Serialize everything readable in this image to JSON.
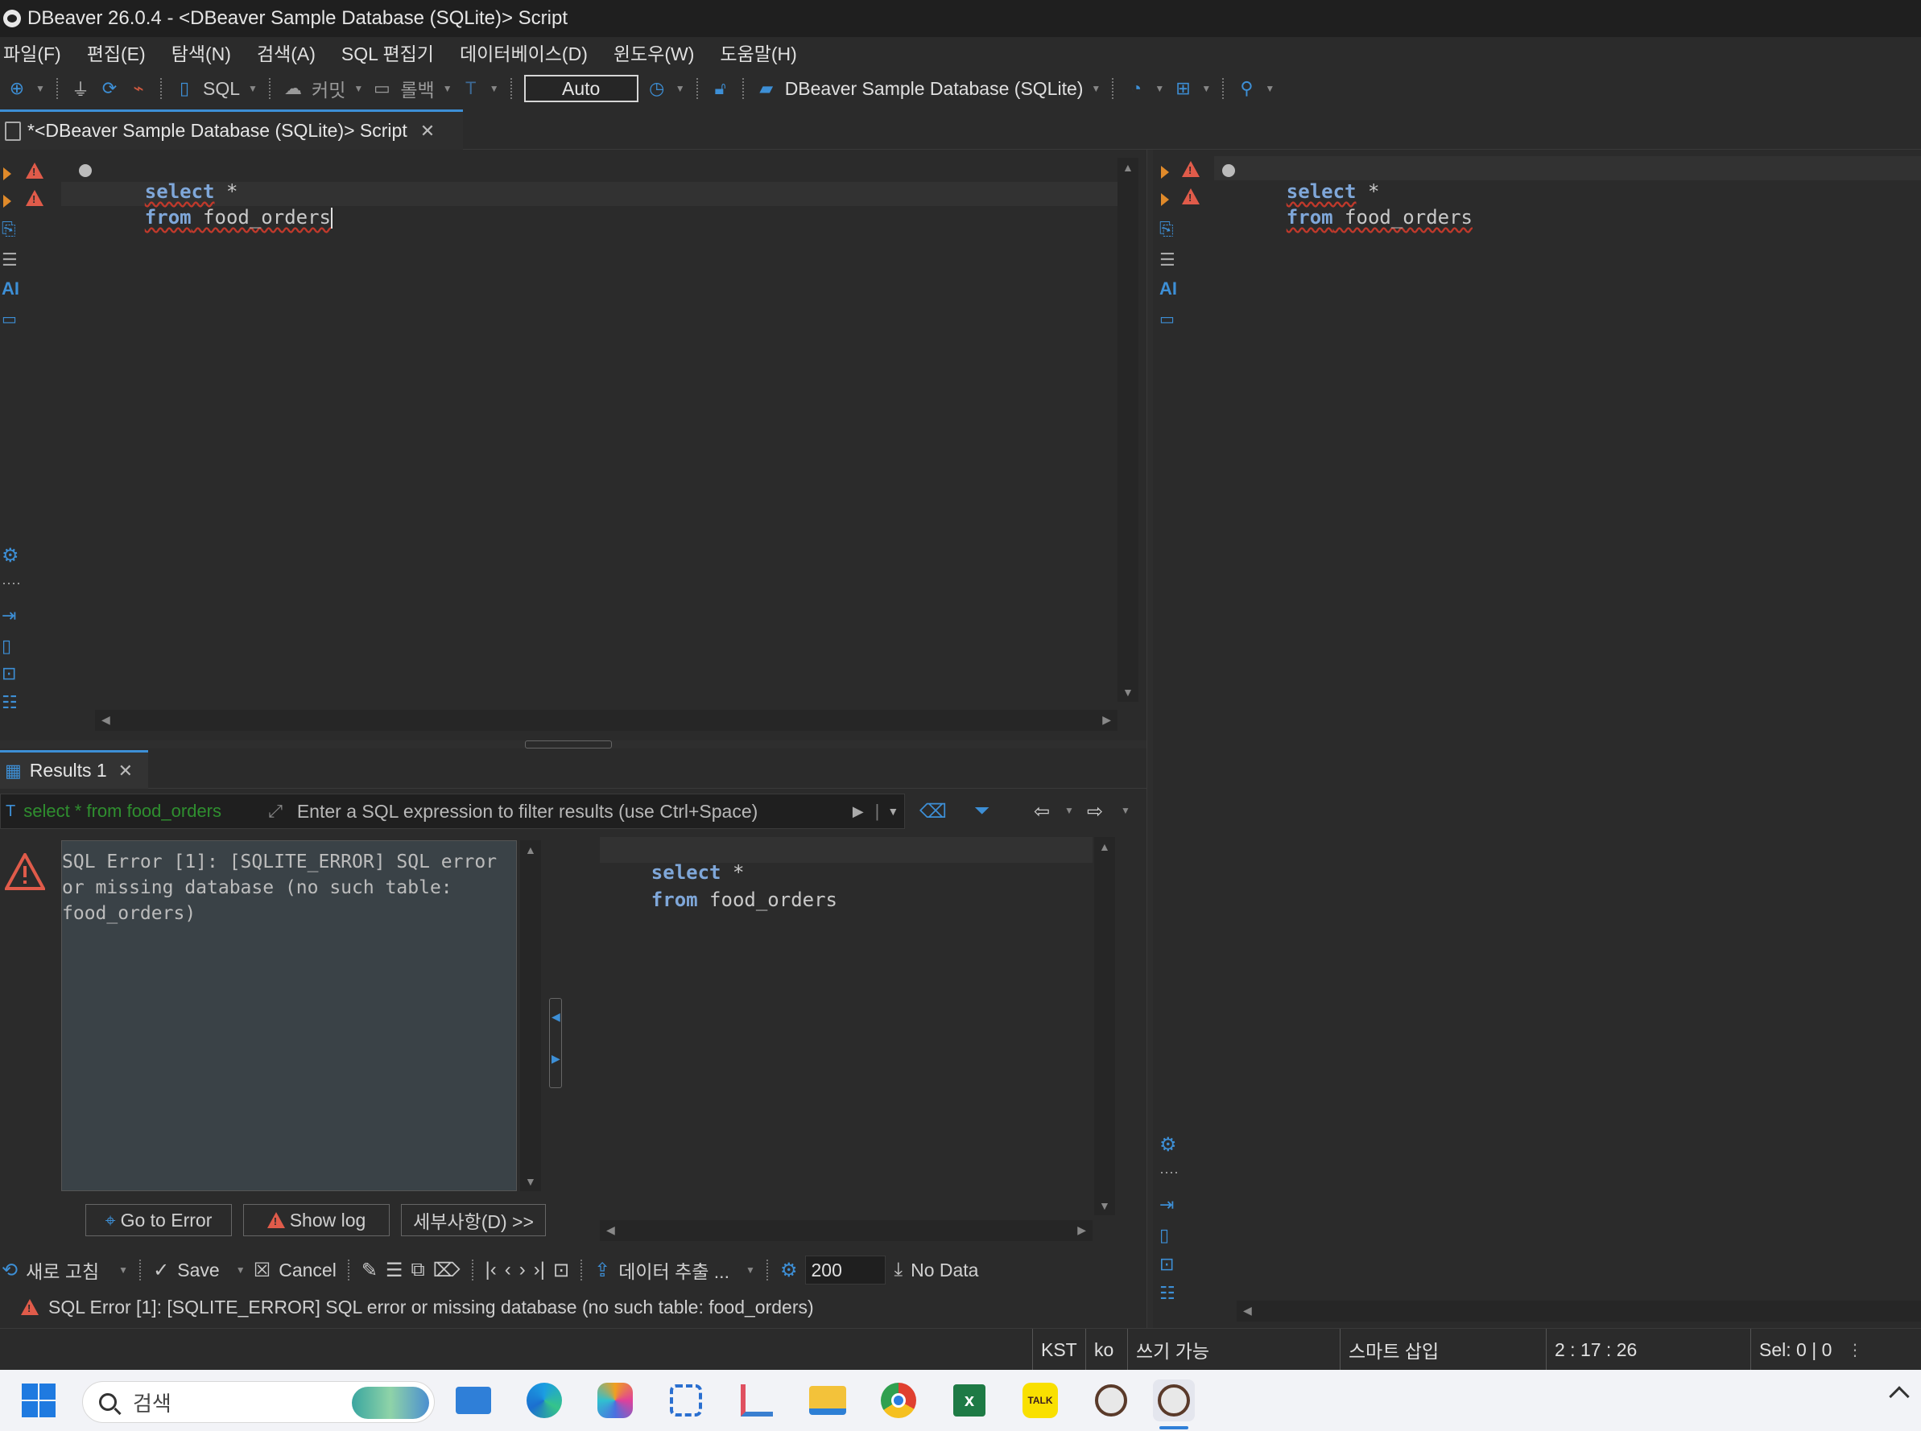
{
  "window": {
    "title": "DBeaver 26.0.4 - <DBeaver Sample Database (SQLite)> Script"
  },
  "menu": [
    "파일(F)",
    "편집(E)",
    "탐색(N)",
    "검색(A)",
    "SQL 편집기",
    "데이터베이스(D)",
    "윈도우(W)",
    "도움말(H)"
  ],
  "toolbar": {
    "sql_label": "SQL",
    "commit_label": "커밋",
    "rollback_label": "롤백",
    "transaction_mode": "Auto",
    "datasource": "DBeaver Sample Database (SQLite)"
  },
  "editor": {
    "tab_label": "*<DBeaver Sample Database (SQLite)> Script",
    "line1_kw": "select",
    "line1_rest": " *",
    "line2_kw": "from",
    "line2_rest": " food_orders"
  },
  "results": {
    "tab_label": "Results 1",
    "filter_query": "select * from food_orders",
    "filter_placeholder": "Enter a SQL expression to filter results (use Ctrl+Space)",
    "error_message": "SQL Error [1]: [SQLITE_ERROR] SQL error or missing database (no such table: food_orders)",
    "go_to_error": "Go to Error",
    "show_log": "Show log",
    "details": "세부사항(D) >>",
    "preview_line1_kw": "select",
    "preview_line1_rest": " *",
    "preview_line2_kw": "from",
    "preview_line2_rest": " food_orders",
    "refresh_label": "새로 고침",
    "save_label": "Save",
    "cancel_label": "Cancel",
    "export_label": "데이터 추출 ...",
    "max_rows": "200",
    "no_data_label": "No Data",
    "status_message": "SQL Error [1]: [SQLITE_ERROR] SQL error or missing database (no such table: food_orders)"
  },
  "statusbar": {
    "timezone": "KST",
    "locale": "ko",
    "writable": "쓰기 가능",
    "insert_mode": "스마트 삽입",
    "position": "2 : 17 : 26",
    "selection": "Sel: 0 | 0"
  },
  "taskbar": {
    "search_placeholder": "검색"
  },
  "colors": {
    "accent": "#3d8fd6",
    "error": "#e05b4a",
    "keyword": "#7fa7d9"
  }
}
